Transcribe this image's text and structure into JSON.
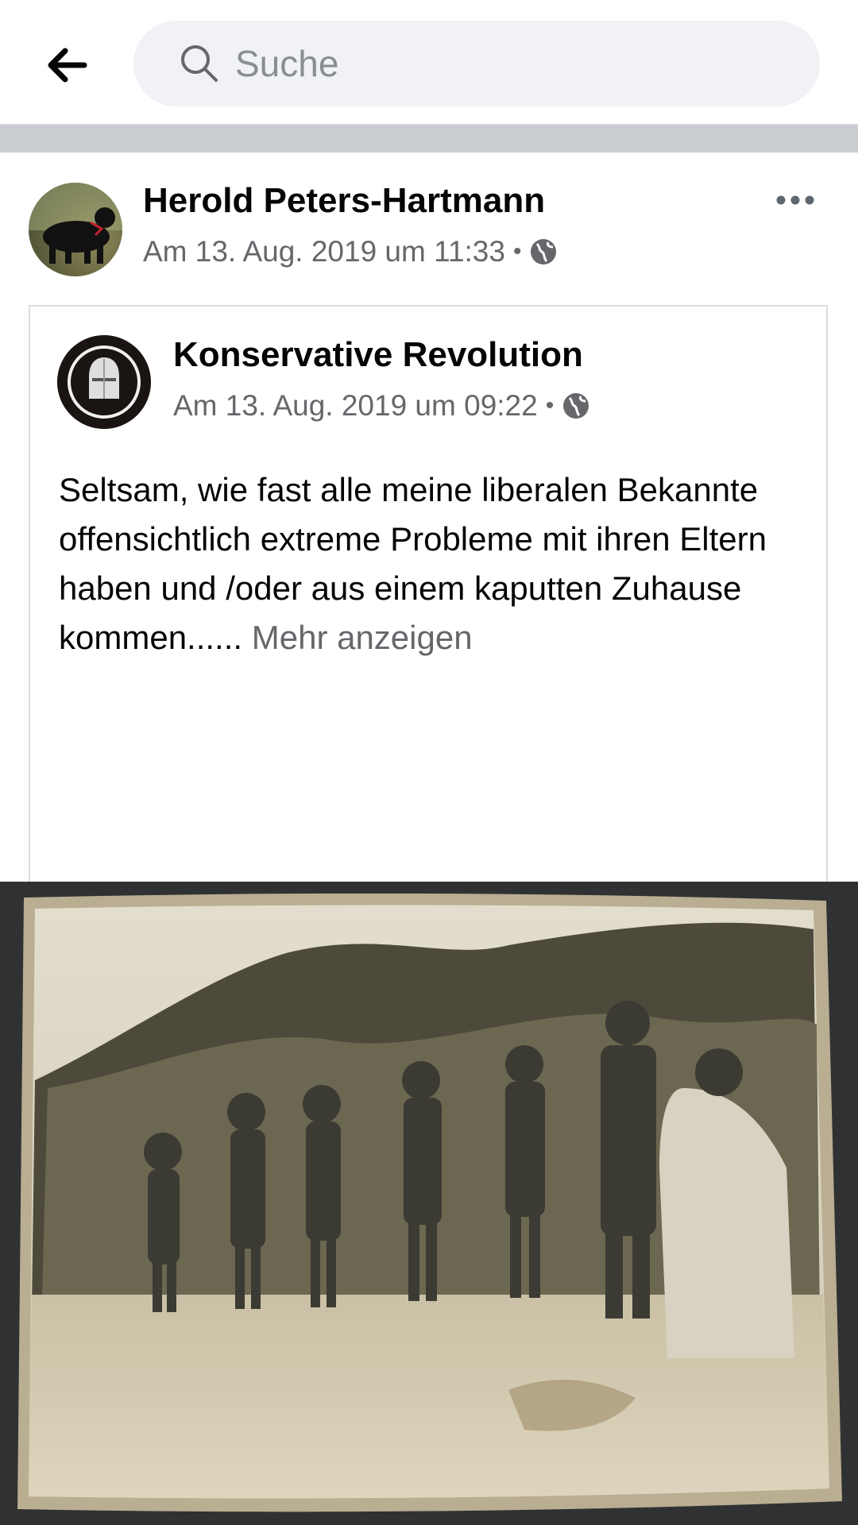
{
  "search": {
    "placeholder": "Suche"
  },
  "post": {
    "author": "Herold Peters-Hartmann",
    "timestamp": "Am 13. Aug. 2019 um 11:33",
    "privacy_icon": "globe-icon",
    "shared": {
      "page_name": "Konservative Revolution",
      "timestamp": "Am 13. Aug. 2019 um 09:22",
      "text": "Seltsam, wie fast alle meine liberalen Bekannte offensichtlich extreme Probleme mit ihren Eltern haben und /oder aus einem kaputten Zuhause kommen......",
      "see_more": "Mehr anzeigen"
    }
  },
  "colors": {
    "secondary_text": "#65676b",
    "search_bg": "#f0f2f5",
    "divider": "#c9ccd1"
  }
}
